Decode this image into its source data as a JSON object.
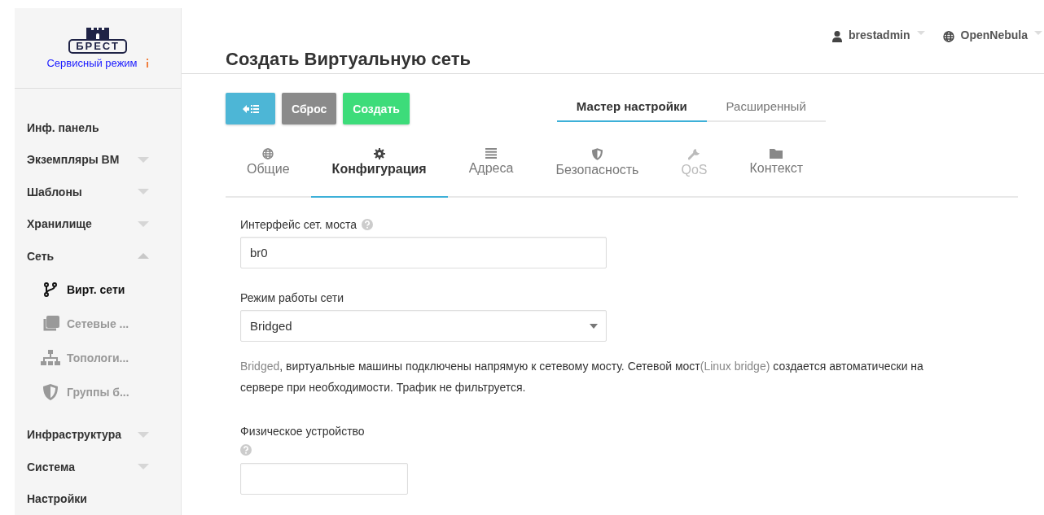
{
  "sidebar": {
    "logo": {
      "text": "БРЕСТ"
    },
    "mode_link": "Сервисный режим",
    "items": [
      {
        "label": "Инф. панель",
        "kind": "link"
      },
      {
        "label": "Экземпляры ВМ",
        "kind": "menu",
        "expanded": false
      },
      {
        "label": "Шаблоны",
        "kind": "menu",
        "expanded": false
      },
      {
        "label": "Хранилище",
        "kind": "menu",
        "expanded": false
      },
      {
        "label": "Сеть",
        "kind": "menu",
        "expanded": true,
        "children": [
          {
            "label": "Вирт. сети",
            "selected": true
          },
          {
            "label": "Сетевые ...",
            "selected": false
          },
          {
            "label": "Топологи...",
            "selected": false
          },
          {
            "label": "Группы б...",
            "selected": false
          }
        ]
      },
      {
        "label": "Инфраструктура",
        "kind": "menu",
        "expanded": false
      },
      {
        "label": "Система",
        "kind": "menu",
        "expanded": false
      },
      {
        "label": "Настройки",
        "kind": "link"
      }
    ]
  },
  "header": {
    "title": "Создать Виртуальную сеть",
    "user": "brestadmin",
    "zone": "OpenNebula"
  },
  "buttons": [
    {
      "kind": "back"
    },
    {
      "kind": "reset",
      "label": "Сброс"
    },
    {
      "kind": "create",
      "label": "Создать"
    }
  ],
  "mode_tabs": [
    {
      "label": "Мастер настройки",
      "selected": true
    },
    {
      "label": "Расширенный",
      "selected": false
    }
  ],
  "step_tabs": [
    {
      "label": "Общие",
      "selected": false,
      "disabled": false
    },
    {
      "label": "Конфигурация",
      "selected": true,
      "disabled": false
    },
    {
      "label": "Адреса",
      "selected": false,
      "disabled": false
    },
    {
      "label": "Безопасность",
      "selected": false,
      "disabled": false
    },
    {
      "label": "QoS",
      "selected": false,
      "disabled": true
    },
    {
      "label": "Контекст",
      "selected": false,
      "disabled": false
    }
  ],
  "fields": [
    {
      "kind": "text",
      "label": "Интерфейс сет. моста",
      "help": true,
      "value": "br0"
    },
    {
      "kind": "select",
      "label": "Режим работы сети",
      "help": false,
      "value": "Bridged",
      "description": [
        {
          "kind": "term",
          "text": "Bridged"
        },
        {
          "kind": "text",
          "text": ", виртуальные машины подключены напрямую к сетевому мосту. Сетевой мост"
        },
        {
          "kind": "term",
          "text": "(Linux bridge)"
        },
        {
          "kind": "text",
          "text": " создается автоматически на сервере при необходимости. Трафик не фильтруется."
        }
      ]
    },
    {
      "kind": "text",
      "label": "Физическое устройство",
      "help": true
    }
  ]
}
